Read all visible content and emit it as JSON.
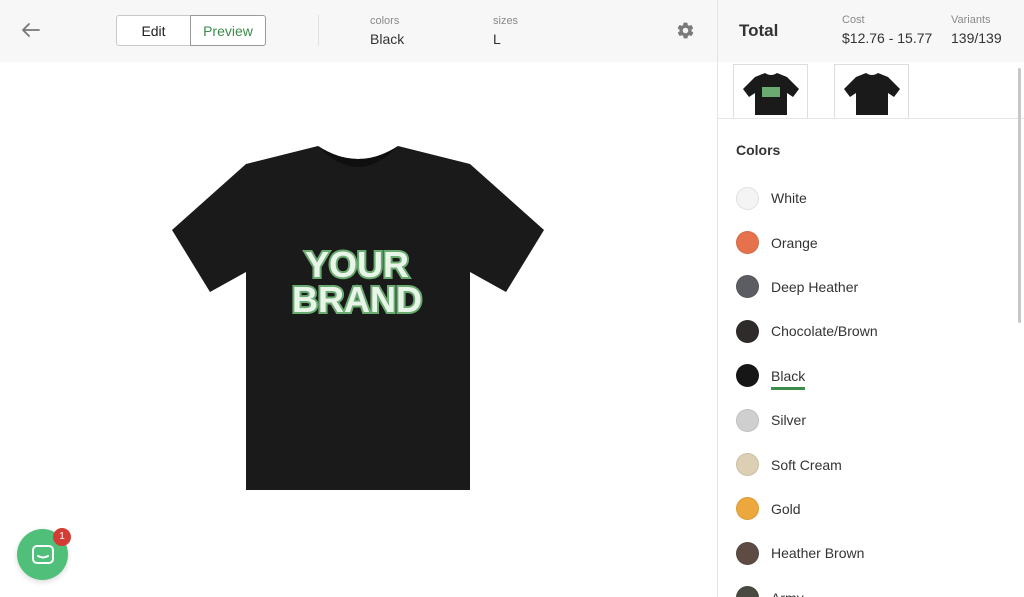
{
  "topbar": {
    "edit_label": "Edit",
    "preview_label": "Preview",
    "colors_label": "colors",
    "colors_value": "Black",
    "sizes_label": "sizes",
    "sizes_value": "L"
  },
  "summary": {
    "total_label": "Total",
    "cost_label": "Cost",
    "cost_value": "$12.76 - 15.77",
    "variants_label": "Variants",
    "variants_value": "139/139"
  },
  "colors_section": {
    "title": "Colors",
    "items": [
      {
        "label": "White",
        "hex": "#f4f4f4"
      },
      {
        "label": "Orange",
        "hex": "#e5724d"
      },
      {
        "label": "Deep Heather",
        "hex": "#5b5d62"
      },
      {
        "label": "Chocolate/Brown",
        "hex": "#2e2b2a"
      },
      {
        "label": "Black",
        "hex": "#161616"
      },
      {
        "label": "Silver",
        "hex": "#cfcfcf"
      },
      {
        "label": "Soft Cream",
        "hex": "#dccfb4"
      },
      {
        "label": "Gold",
        "hex": "#eda83d"
      },
      {
        "label": "Heather Brown",
        "hex": "#5e4c44"
      },
      {
        "label": "Army",
        "hex": "#4a4a42"
      }
    ],
    "selected": "Black"
  },
  "mockup": {
    "brand_line1": "YOUR",
    "brand_line2": "BRAND",
    "brand_color": "#6aab72",
    "shirt_color": "#1a1a1a"
  },
  "chat": {
    "badge_count": "1"
  },
  "accent_color": "#3d8b4a"
}
